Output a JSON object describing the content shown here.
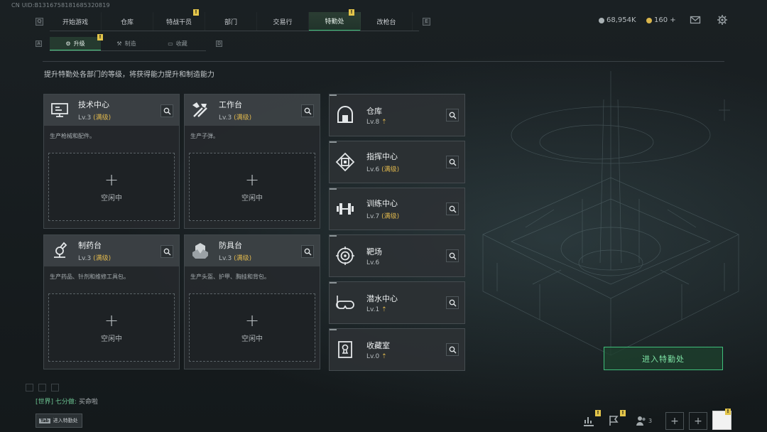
{
  "uid": "CN UID:B131675818168532081​9",
  "nav": {
    "left_key": "Q",
    "right_key": "E",
    "tabs": [
      {
        "label": "开始游戏",
        "badge": ""
      },
      {
        "label": "仓库",
        "badge": ""
      },
      {
        "label": "特战干员",
        "badge": "!"
      },
      {
        "label": "部门",
        "badge": ""
      },
      {
        "label": "交易行",
        "badge": ""
      },
      {
        "label": "特勤处",
        "badge": "!",
        "active": true
      },
      {
        "label": "改枪台",
        "badge": ""
      }
    ]
  },
  "currency": {
    "money": "68,954K",
    "coins": "160 +"
  },
  "subnav": {
    "left_key": "A",
    "right_key": "D",
    "tabs": [
      {
        "label": "升级",
        "badge": "!",
        "active": true
      },
      {
        "label": "制造",
        "badge": ""
      },
      {
        "label": "收藏",
        "badge": ""
      }
    ]
  },
  "description": "提升特勤处各部门的等级，将获得能力提升和制造能力",
  "workshops": [
    {
      "name": "技术中心",
      "level": "Lv.3",
      "status": "(满级)",
      "desc": "生产枪械和配件。",
      "slot_label": "空闲中",
      "icon": "tech-center-icon"
    },
    {
      "name": "工作台",
      "level": "Lv.3",
      "status": "(满级)",
      "desc": "生产子弹。",
      "slot_label": "空闲中",
      "icon": "workbench-icon"
    },
    {
      "name": "制药台",
      "level": "Lv.3",
      "status": "(满级)",
      "desc": "生产药品、针剂和维修工具包。",
      "slot_label": "空闲中",
      "icon": "pharmacy-icon"
    },
    {
      "name": "防具台",
      "level": "Lv.3",
      "status": "(满级)",
      "desc": "生产头盔、护甲、胸挂和背包。",
      "slot_label": "空闲中",
      "icon": "armor-bench-icon"
    }
  ],
  "facilities": [
    {
      "name": "仓库",
      "level": "Lv.8",
      "status": "",
      "upgradable": true,
      "icon": "warehouse-icon"
    },
    {
      "name": "指挥中心",
      "level": "Lv.6",
      "status": "(满级)",
      "upgradable": false,
      "icon": "command-center-icon"
    },
    {
      "name": "训练中心",
      "level": "Lv.7",
      "status": "(满级)",
      "upgradable": false,
      "icon": "training-center-icon"
    },
    {
      "name": "靶场",
      "level": "Lv.6",
      "status": "",
      "upgradable": false,
      "icon": "shooting-range-icon"
    },
    {
      "name": "潜水中心",
      "level": "Lv.1",
      "status": "",
      "upgradable": true,
      "icon": "diving-center-icon"
    },
    {
      "name": "收藏室",
      "level": "Lv.0",
      "status": "",
      "upgradable": true,
      "icon": "collection-room-icon"
    }
  ],
  "enter_button": "进入特勤处",
  "chat": {
    "channel": "[世界]",
    "sender": "七分做:",
    "message": "买命啦"
  },
  "bottom_hint": {
    "key": "Tab",
    "label": "进入特勤处"
  },
  "bottom_bar": {
    "squad_count": "3"
  },
  "colors": {
    "accent": "#3fbf7a",
    "gold": "#e0b84d",
    "badge": "#e3c54a"
  }
}
